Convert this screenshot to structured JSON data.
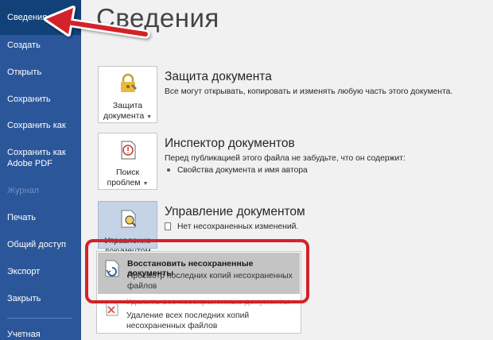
{
  "sidebar": {
    "items": [
      {
        "label": "Сведения"
      },
      {
        "label": "Создать"
      },
      {
        "label": "Открыть"
      },
      {
        "label": "Сохранить"
      },
      {
        "label": "Сохранить как"
      },
      {
        "label": "Сохранить как Adobe PDF"
      },
      {
        "label": "Журнал"
      },
      {
        "label": "Печать"
      },
      {
        "label": "Общий доступ"
      },
      {
        "label": "Экспорт"
      },
      {
        "label": "Закрыть"
      },
      {
        "label": "Учетная"
      }
    ]
  },
  "page": {
    "title": "Сведения"
  },
  "sections": [
    {
      "tile_label_1": "Защита",
      "tile_label_2": "документа",
      "title": "Защита документа",
      "text": "Все могут открывать, копировать и изменять любую часть этого документа."
    },
    {
      "tile_label_1": "Поиск",
      "tile_label_2": "проблем",
      "title": "Инспектор документов",
      "text": "Перед публикацией этого файла не забудьте, что он содержит:",
      "bullet": "Свойства документа и имя автора"
    },
    {
      "tile_label_1": "Управление",
      "tile_label_2": "документом",
      "title": "Управление документом",
      "text": "Нет несохраненных изменений."
    }
  ],
  "dropdown": {
    "item1_title": "Восстановить несохраненные документы",
    "item1_sub1": "Просмотр последних копий несохраненных",
    "item1_sub2": "файлов",
    "item2_title": "Удалить все несохраненные документы",
    "item2_sub1": "Удаление всех последних копий",
    "item2_sub2": "несохраненных файлов"
  },
  "colors": {
    "sidebar": "#2b579a",
    "sidebar_active": "#124078",
    "annotation": "#d3222a"
  }
}
